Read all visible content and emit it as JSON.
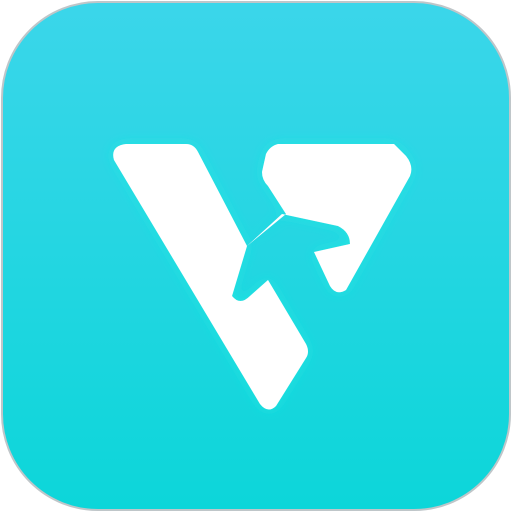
{
  "app_icon": {
    "icon": "v-plane-logo-icon",
    "colors": {
      "background_top": "#3bd6ea",
      "background_bottom": "#0cd6d9",
      "border": "#bfc6c9",
      "glyph": "#ffffff",
      "glow": "#1fe8e2"
    }
  }
}
